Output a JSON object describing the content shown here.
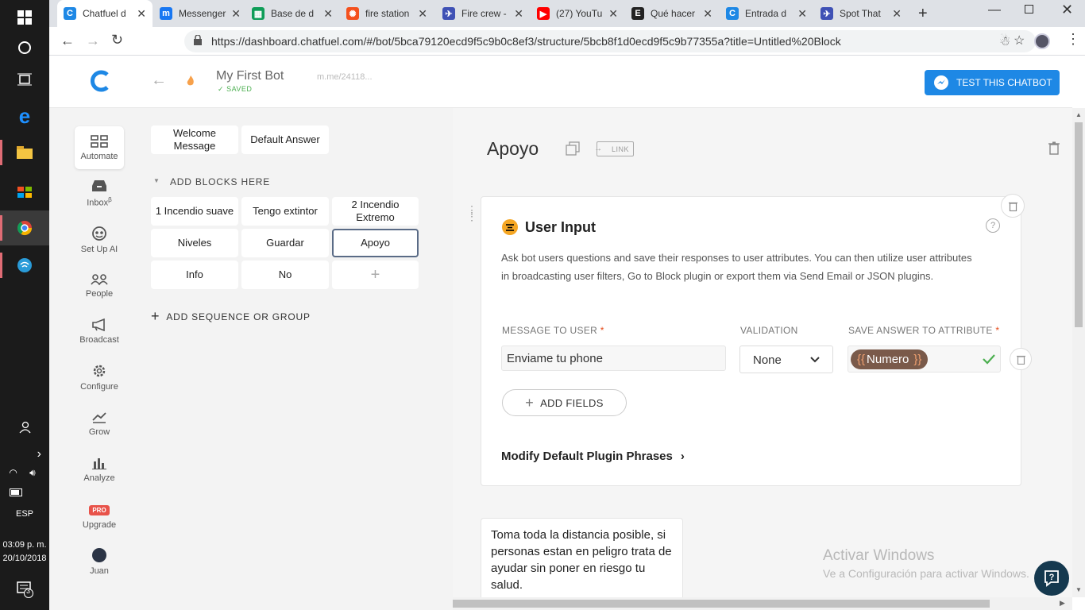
{
  "taskbar": {
    "lang": "ESP",
    "time": "03:09 p. m.",
    "date": "20/10/2018",
    "notif_count": "3"
  },
  "browser": {
    "tabs": [
      {
        "title": "Chatfuel d",
        "color": "#1e88e5",
        "glyph": "C",
        "active": true
      },
      {
        "title": "Messenger",
        "color": "#1877f2",
        "glyph": "m",
        "active": false
      },
      {
        "title": "Base de d",
        "color": "#0f9d58",
        "glyph": "▦",
        "active": false
      },
      {
        "title": "fire station",
        "color": "#f4511e",
        "glyph": "✺",
        "active": false
      },
      {
        "title": "Fire crew -",
        "color": "#3f51b5",
        "glyph": "✈",
        "active": false
      },
      {
        "title": "(27) YouTu",
        "color": "#ff0000",
        "glyph": "▶",
        "active": false
      },
      {
        "title": "Qué hacer",
        "color": "#222222",
        "glyph": "E",
        "active": false
      },
      {
        "title": "Entrada d",
        "color": "#1e88e5",
        "glyph": "C",
        "active": false
      },
      {
        "title": "Spot That",
        "color": "#3f51b5",
        "glyph": "✈",
        "active": false
      }
    ],
    "url": "https://dashboard.chatfuel.com/#/bot/5bca79120ecd9f5c9b0c8ef3/structure/5bcb8f1d0ecd9f5c9b77355a?title=Untitled%20Block"
  },
  "header": {
    "bot_name": "My First Bot",
    "saved": "SAVED",
    "link": "m.me/24118...",
    "test_button": "TEST THIS CHATBOT"
  },
  "nav": [
    {
      "label": "Automate",
      "icon": "automate-icon"
    },
    {
      "label": "Inbox",
      "sup": "β",
      "icon": "inbox-icon"
    },
    {
      "label": "Set Up AI",
      "icon": "ai-icon"
    },
    {
      "label": "People",
      "icon": "people-icon"
    },
    {
      "label": "Broadcast",
      "icon": "megaphone-icon"
    },
    {
      "label": "Configure",
      "icon": "gear-icon"
    },
    {
      "label": "Grow",
      "icon": "grow-icon"
    },
    {
      "label": "Analyze",
      "icon": "chart-icon"
    },
    {
      "label": "Upgrade",
      "badge": "PRO",
      "icon": "pro-badge"
    },
    {
      "label": "Juan",
      "icon": "avatar"
    }
  ],
  "blocks": {
    "top": [
      "Welcome Message",
      "Default Answer"
    ],
    "group_title": "ADD BLOCKS HERE",
    "items": [
      "1 Incendio suave",
      "Tengo extintor",
      "2 Incendio Extremo",
      "Niveles",
      "Guardar",
      "Apoyo",
      "Info",
      "No"
    ],
    "add_sequence": "ADD SEQUENCE OR GROUP"
  },
  "editor": {
    "block_title": "Apoyo",
    "link_label": "LINK",
    "plugin": {
      "title": "User Input",
      "description": "Ask bot users questions and save their responses to user attributes. You can then utilize user attributes in broadcasting user filters, Go to Block plugin or export them via Send Email or JSON plugins.",
      "message_label": "MESSAGE TO USER",
      "validation_label": "VALIDATION",
      "save_label": "SAVE ANSWER TO ATTRIBUTE",
      "message_value": "Enviame tu phone",
      "validation_value": "None",
      "attribute_value": "Numero",
      "add_fields": "ADD FIELDS",
      "modify_phrases": "Modify Default Plugin Phrases"
    },
    "text_card": "Toma toda la distancia posible, si personas estan en peligro trata de ayudar sin poner en riesgo tu salud."
  },
  "watermark": {
    "title": "Activar Windows",
    "subtitle": "Ve a Configuración para activar Windows."
  },
  "colors": {
    "accent": "#1e88e5",
    "attribute_chip": "#7a5a4a",
    "attribute_brace": "#f0a070",
    "check": "#4caf50",
    "icon_yellow": "#f5a623"
  }
}
